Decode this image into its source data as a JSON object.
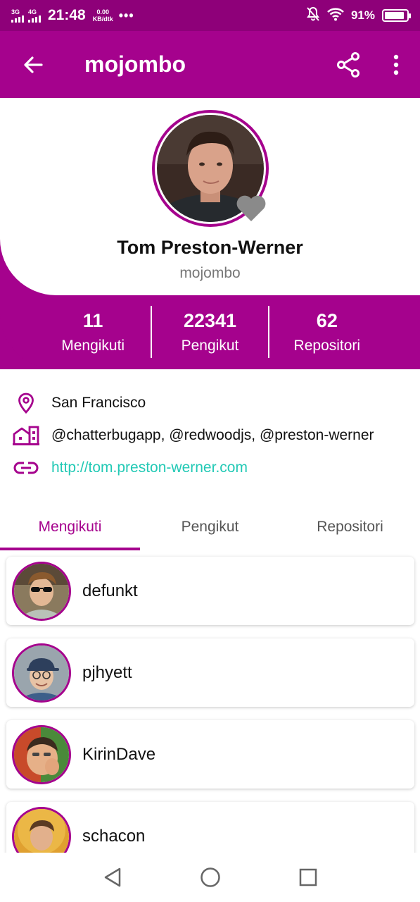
{
  "status_bar": {
    "net1": "3G",
    "net2": "4G",
    "time": "21:48",
    "speed_top": "0.00",
    "speed_bottom": "KB/dtk",
    "more": "•••",
    "battery": "91%",
    "battery_level": 0.91
  },
  "app_bar": {
    "title": "mojombo",
    "back_icon": "arrow-back-icon",
    "share_icon": "share-icon",
    "menu_icon": "more-vert-icon"
  },
  "profile": {
    "name": "Tom Preston-Werner",
    "login": "mojombo",
    "favorite_icon": "heart-icon"
  },
  "stats": [
    {
      "value": "11",
      "label": "Mengikuti"
    },
    {
      "value": "22341",
      "label": "Pengikut"
    },
    {
      "value": "62",
      "label": "Repositori"
    }
  ],
  "info": {
    "location": "San Francisco",
    "company": "@chatterbugapp, @redwoodjs, @preston-werner",
    "blog": "http://tom.preston-werner.com"
  },
  "tabs": [
    {
      "label": "Mengikuti",
      "active": true
    },
    {
      "label": "Pengikut",
      "active": false
    },
    {
      "label": "Repositori",
      "active": false
    }
  ],
  "following": [
    {
      "login": "defunkt"
    },
    {
      "login": "pjhyett"
    },
    {
      "login": "KirinDave"
    },
    {
      "login": "schacon"
    }
  ],
  "colors": {
    "primary": "#a5028d",
    "status_bar": "#8e0079",
    "link": "#22c9b5"
  }
}
